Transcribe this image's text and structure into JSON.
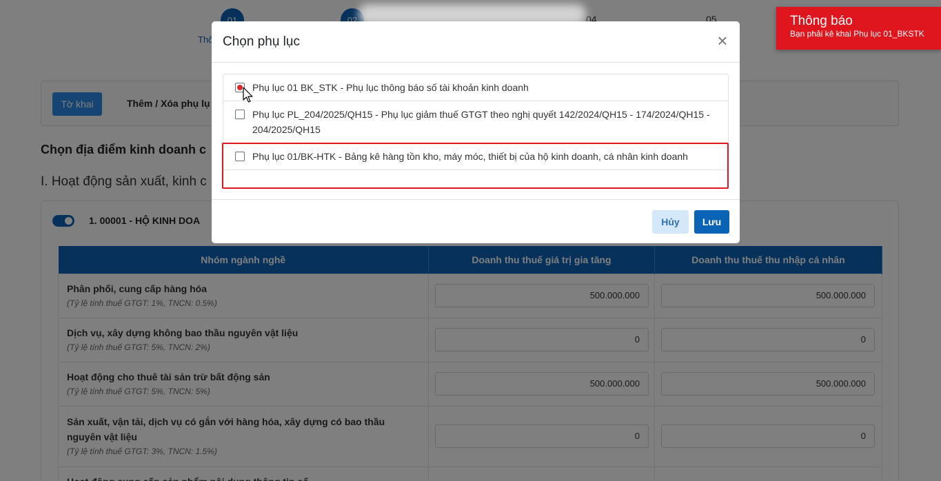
{
  "steps": [
    {
      "num": "01",
      "label": "Thô"
    },
    {
      "num": "02",
      "label": ""
    },
    {
      "num": "04",
      "label": ""
    },
    {
      "num": "05",
      "label": ""
    }
  ],
  "tabs": {
    "active_label": "Tờ khai",
    "add_remove_label": "Thêm / Xóa phụ lụ"
  },
  "headings": {
    "location": "Chọn địa điểm kinh doanh c",
    "activity": "I. Hoạt động sản xuất, kinh c"
  },
  "business": {
    "title": "1. 00001 - HỘ KINH DOA"
  },
  "table": {
    "headers": [
      "Nhóm ngành nghề",
      "Doanh thu thuế giá trị gia tăng",
      "Doanh thu thuế thu nhập cá nhân"
    ],
    "rows": [
      {
        "name": "Phân phối, cung cấp hàng hóa",
        "rate": "(Tỷ lệ tính thuế GTGT: 1%, TNCN: 0.5%)",
        "vat": "500.000.000",
        "pit": "500.000.000"
      },
      {
        "name": "Dịch vụ, xây dựng không bao thầu nguyên vật liệu",
        "rate": "(Tỷ lệ tính thuế GTGT: 5%, TNCN: 2%)",
        "vat": "0",
        "pit": "0"
      },
      {
        "name": "Hoạt động cho thuê tài sản trừ bất động sản",
        "rate": "(Tỷ lệ tính thuế GTGT: 5%, TNCN: 5%)",
        "vat": "500.000.000",
        "pit": "500.000.000"
      },
      {
        "name": "Sản xuất, vận tải, dịch vụ có gắn với hàng hóa, xây dựng có bao thầu nguyên vật liệu",
        "rate": "(Tỷ lệ tính thuế GTGT: 3%, TNCN: 1.5%)",
        "vat": "0",
        "pit": "0"
      },
      {
        "name": "Hoạt động cung cấp sản phẩm nội dung thông tin số",
        "rate": "",
        "vat": "",
        "pit": ""
      }
    ]
  },
  "modal": {
    "title": "Chọn phụ lục",
    "close_symbol": "×",
    "items": [
      {
        "label": "Phụ lục 01 BK_STK - Phụ lục thông báo số tài khoản kinh doanh"
      },
      {
        "label": "Phụ lục PL_204/2025/QH15 - Phụ lục giảm thuế GTGT theo nghị quyết 142/2024/QH15 - 174/2024/QH15 - 204/2025/QH15"
      },
      {
        "label": "Phụ lục 01/BK-HTK - Bảng kê hàng tồn kho, máy móc, thiết bị của hộ kinh doanh, cá nhân kinh doanh"
      }
    ],
    "cancel_label": "Hủy",
    "save_label": "Lưu"
  },
  "toast": {
    "title": "Thông báo",
    "message": "Bạn phải kê khai Phụ lục 01_BKSTK"
  },
  "colors": {
    "primary": "#0b63b6",
    "toast": "#e0161f",
    "highlight": "#e0161f"
  }
}
